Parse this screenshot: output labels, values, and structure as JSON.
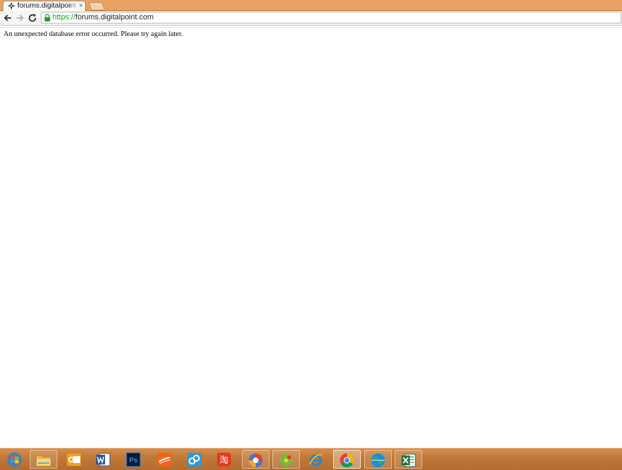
{
  "tab": {
    "title": "forums.digitalpoint.com",
    "close_glyph": "×",
    "favicon": "digitalpoint-favicon"
  },
  "toolbar": {
    "back_icon": "back-arrow-icon",
    "forward_icon": "forward-arrow-icon",
    "reload_icon": "reload-icon",
    "url_scheme": "https://",
    "url_host": "forums.digitalpoint.com",
    "secure_color": "#17a11d"
  },
  "page": {
    "error_text": "An unexpected database error occurred. Please try again later."
  },
  "taskbar": {
    "color": "#c07a3a",
    "items": [
      {
        "name": "start-button",
        "icon": "windows-orb-icon",
        "state": "none"
      },
      {
        "name": "file-explorer",
        "icon": "folder-icon",
        "state": "pinned"
      },
      {
        "name": "outlook",
        "icon": "outlook-icon",
        "state": "none"
      },
      {
        "name": "word",
        "icon": "word-icon",
        "state": "none"
      },
      {
        "name": "photoshop",
        "icon": "photoshop-icon",
        "label": "Ps",
        "state": "none"
      },
      {
        "name": "app-orange",
        "icon": "orange-swoosh-icon",
        "state": "none"
      },
      {
        "name": "app-blue",
        "icon": "blue-cloud-icon",
        "state": "none"
      },
      {
        "name": "taobao",
        "icon": "taobao-icon",
        "label": "淘",
        "state": "none"
      },
      {
        "name": "app-swirl",
        "icon": "swirl-icon",
        "state": "pinned"
      },
      {
        "name": "icq",
        "icon": "icq-flower-icon",
        "state": "pinned"
      },
      {
        "name": "internet-explorer",
        "icon": "ie-icon",
        "state": "none"
      },
      {
        "name": "chrome",
        "icon": "chrome-icon",
        "state": "active"
      },
      {
        "name": "globe-app",
        "icon": "globe-icon",
        "state": "pinned"
      },
      {
        "name": "excel",
        "icon": "excel-icon",
        "state": "pinned"
      }
    ]
  }
}
